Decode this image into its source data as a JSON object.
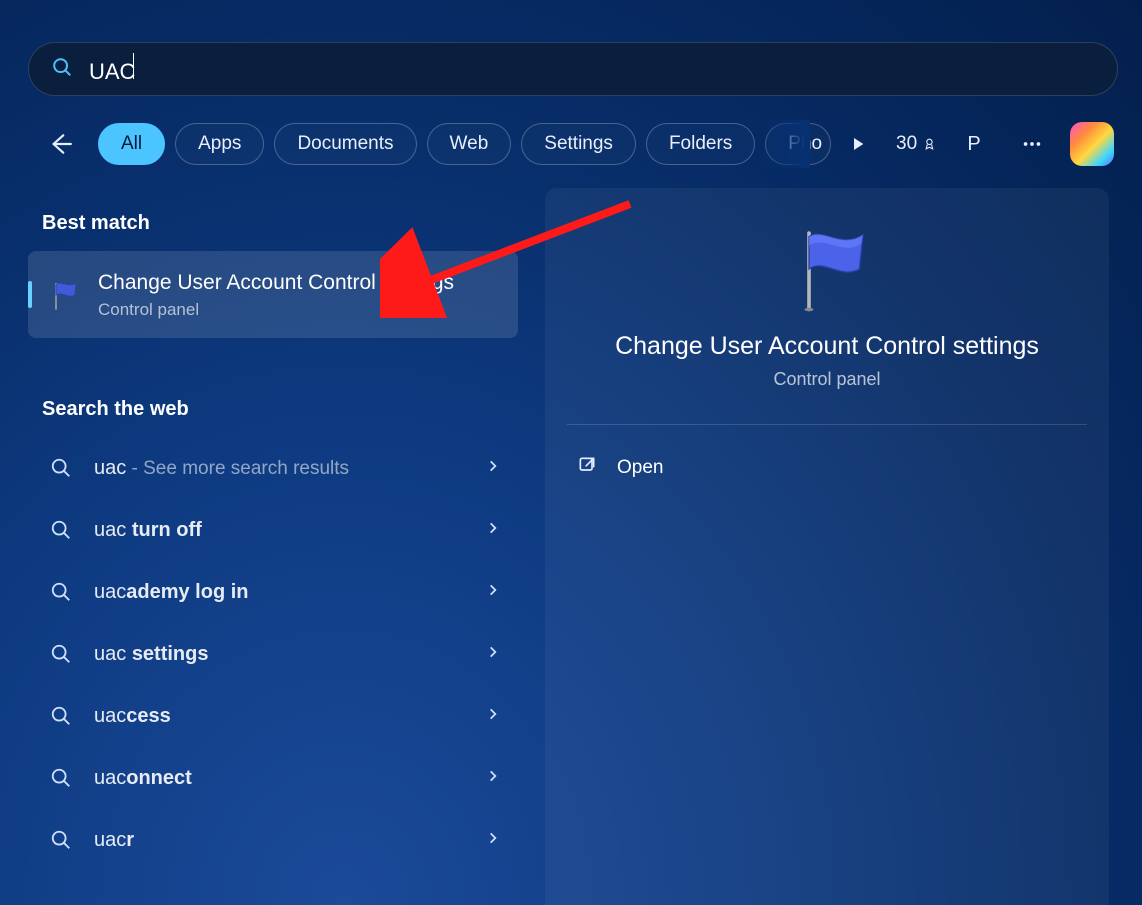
{
  "search": {
    "query": "UAC"
  },
  "filters": {
    "items": [
      "All",
      "Apps",
      "Documents",
      "Web",
      "Settings",
      "Folders",
      "Pho"
    ],
    "active_index": 0
  },
  "toolbar_right": {
    "rewards_points": "30",
    "profile_initial": "P"
  },
  "left": {
    "best_match_heading": "Best match",
    "best_match": {
      "title": "Change User Account Control settings",
      "subtitle": "Control panel"
    },
    "web_heading": "Search the web",
    "web_results": [
      {
        "prefix": "uac",
        "bold": "",
        "suffix": " - See more search results"
      },
      {
        "prefix": "uac ",
        "bold": "turn off",
        "suffix": ""
      },
      {
        "prefix": "uac",
        "bold": "ademy log in",
        "suffix": ""
      },
      {
        "prefix": "uac ",
        "bold": "settings",
        "suffix": ""
      },
      {
        "prefix": "uac",
        "bold": "cess",
        "suffix": ""
      },
      {
        "prefix": "uac",
        "bold": "onnect",
        "suffix": ""
      },
      {
        "prefix": "uac",
        "bold": "r",
        "suffix": ""
      }
    ]
  },
  "panel": {
    "title": "Change User Account Control settings",
    "subtitle": "Control panel",
    "action_open": "Open"
  }
}
